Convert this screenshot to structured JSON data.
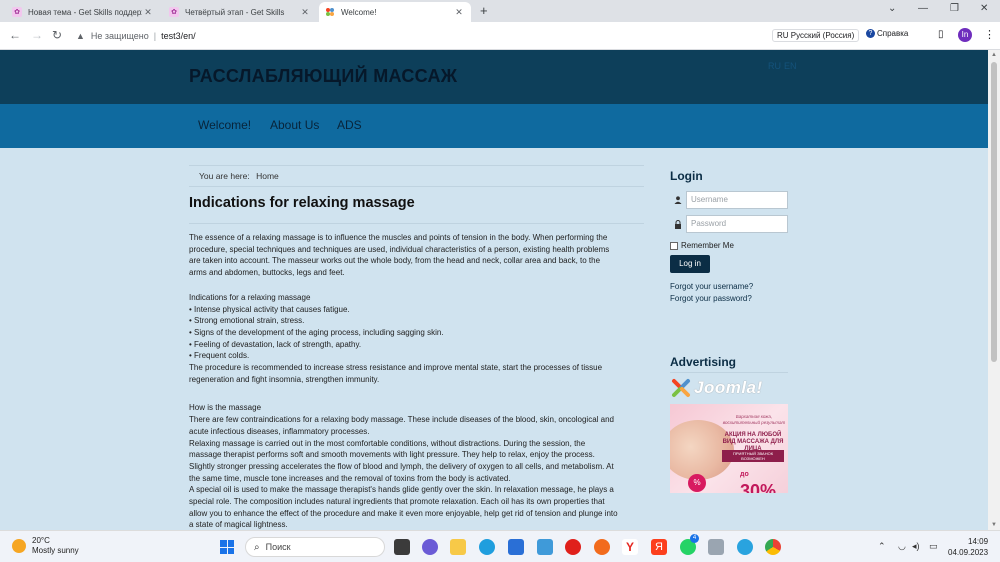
{
  "browser": {
    "tabs": [
      {
        "title": "Новая тема - Get Skills поддерж",
        "active": false
      },
      {
        "title": "Четвёртый этап - Get Skills",
        "active": false
      },
      {
        "title": "Welcome!",
        "active": true
      }
    ],
    "security_label": "Не защищено",
    "url": "test3/en/",
    "translate_label": "RU Русский (Россия)",
    "help_label": "Справка",
    "profile_initials": "In"
  },
  "site": {
    "title": "РАССЛАБЛЯЮЩИЙ МАССАЖ",
    "languages": [
      "RU",
      "EN"
    ],
    "menu": [
      "Welcome!",
      "About Us",
      "ADS"
    ],
    "breadcrumb": {
      "prefix": "You are here:",
      "current": "Home"
    },
    "article": {
      "title": "Indications for relaxing massage",
      "paragraphs": [
        [
          "The essence of a relaxing massage is to influence the muscles and points of tension in the body. When performing the",
          "procedure, special techniques and techniques are used, individual characteristics of a person, existing health problems",
          "are taken into account. The masseur works out the whole body, from the head and neck, collar area and back, to the",
          "arms and abdomen, buttocks, legs and feet."
        ],
        [
          "Indications for a relaxing massage",
          "• Intense physical activity that causes fatigue.",
          "• Strong emotional strain, stress.",
          "• Signs of the development of the aging process, including sagging skin.",
          "• Feeling of devastation, lack of strength, apathy.",
          "• Frequent colds.",
          "The procedure is recommended to increase stress resistance and improve mental state, start the processes of tissue",
          "regeneration and fight insomnia, strengthen immunity."
        ],
        [
          "How is the massage",
          "There are few contraindications for a relaxing body massage. These include diseases of the blood, skin, oncological and",
          "acute infectious diseases, inflammatory processes.",
          "Relaxing massage is carried out in the most comfortable conditions, without distractions. During the session, the",
          "massage therapist performs soft and smooth movements with light pressure. They help to relax, enjoy the process.",
          "Slightly stronger pressing accelerates the flow of blood and lymph, the delivery of oxygen to all cells, and metabolism. At",
          "the same time, muscle tone increases and the removal of toxins from the body is activated.",
          "A special oil is used to make the massage therapist's hands glide gently over the skin. In relaxation message, he plays a",
          "special role. The composition includes natural ingredients that promote relaxation. Each oil has its own properties that",
          "allow you to enhance the effect of the procedure and make it even more enjoyable, help get rid of tension and plunge into",
          "a state of magical lightness."
        ]
      ]
    },
    "login": {
      "heading": "Login",
      "username_placeholder": "Username",
      "password_placeholder": "Password",
      "remember_label": "Remember Me",
      "button_label": "Log in",
      "forgot_username": "Forgot your username?",
      "forgot_password": "Forgot your password?"
    },
    "advertising": {
      "heading": "Advertising",
      "logo_text": "Joomla!",
      "promo": {
        "line1": "Бархатная кожа, восхитительный результат",
        "line2": "АКЦИЯ НА ЛЮБОЙ ВИД МАССАЖА ДЛЯ ЛИЦА",
        "line3": "ПРИЯТНЫЙ ЗВАНОК ВОЗМОЖЕН",
        "discount_prefix": "до",
        "discount": "30%",
        "badge": "%"
      }
    }
  },
  "taskbar": {
    "weather_temp": "20°C",
    "weather_desc": "Mostly sunny",
    "search_label": "Поиск",
    "time": "14:09",
    "date": "04.09.2023",
    "telegram_badge": "4"
  },
  "colors": {
    "header_bg": "#0d3f5a",
    "menu_bg": "#0f6a9f",
    "page_bg": "#d0e3ef",
    "button_bg": "#0b2d45"
  }
}
